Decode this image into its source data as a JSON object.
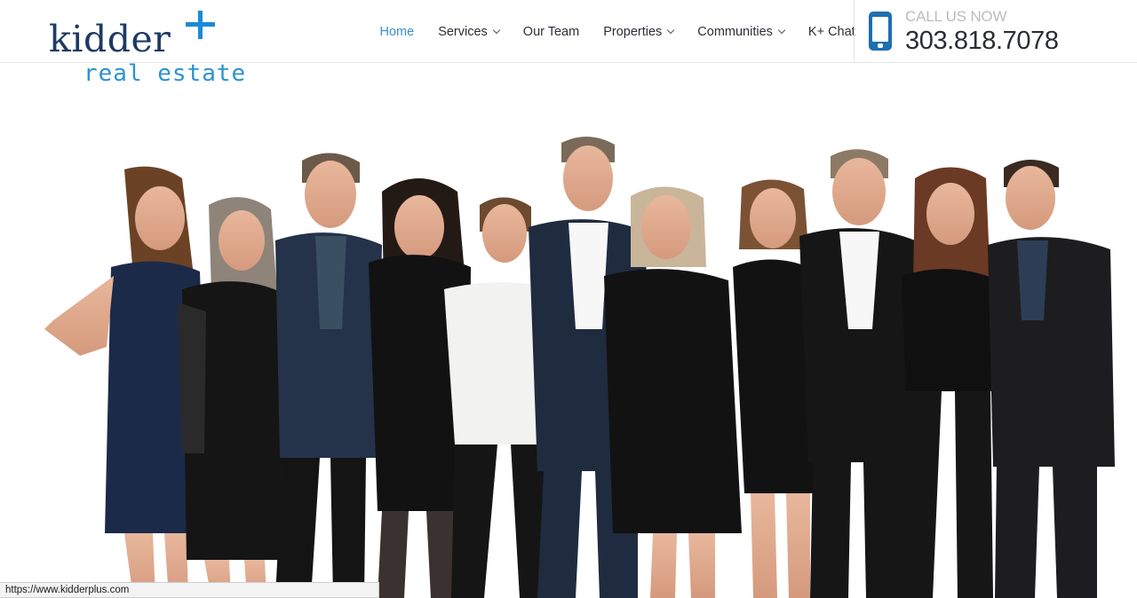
{
  "brand": {
    "word": "kidder",
    "sub": "real estate"
  },
  "nav": {
    "items": [
      {
        "label": "Home",
        "active": true,
        "dropdown": false
      },
      {
        "label": "Services",
        "active": false,
        "dropdown": true
      },
      {
        "label": "Our Team",
        "active": false,
        "dropdown": false
      },
      {
        "label": "Properties",
        "active": false,
        "dropdown": true
      },
      {
        "label": "Communities",
        "active": false,
        "dropdown": true
      },
      {
        "label": "K+ Chat",
        "active": false,
        "dropdown": false
      }
    ]
  },
  "call": {
    "label": "CALL US NOW",
    "number": "303.818.7078",
    "icon": "mobile-phone-icon"
  },
  "status": {
    "url": "https://www.kidderplus.com"
  },
  "colors": {
    "brand_navy": "#1d3a63",
    "brand_blue": "#1a8ad6",
    "active_nav": "#3c8fd0",
    "phone_icon": "#1e6fb0"
  }
}
